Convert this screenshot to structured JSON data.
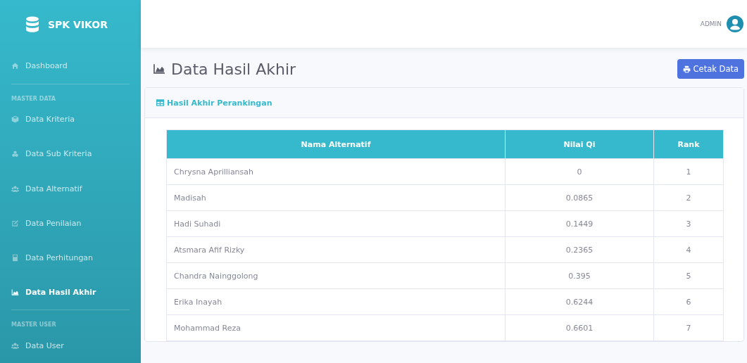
{
  "sidebar": {
    "brand": "SPK VIKOR",
    "items": [
      {
        "kind": "item",
        "label": "Dashboard",
        "selected": false
      },
      {
        "kind": "divider"
      },
      {
        "kind": "heading",
        "label": "MASTER DATA"
      },
      {
        "kind": "item",
        "label": "Data Kriteria",
        "selected": false
      },
      {
        "kind": "item",
        "label": "Data Sub Kriteria",
        "selected": false
      },
      {
        "kind": "item",
        "label": "Data Alternatif",
        "selected": false
      },
      {
        "kind": "item",
        "label": "Data Penilaian",
        "selected": false
      },
      {
        "kind": "item",
        "label": "Data Perhitungan",
        "selected": false
      },
      {
        "kind": "item",
        "label": "Data Hasil Akhir",
        "selected": true
      },
      {
        "kind": "divider"
      },
      {
        "kind": "heading",
        "label": "MASTER USER"
      },
      {
        "kind": "item",
        "label": "Data User",
        "selected": false
      }
    ]
  },
  "topbar": {
    "user": "ADMIN"
  },
  "page": {
    "title": "Data Hasil Akhir",
    "print_button": "Cetak Data"
  },
  "card": {
    "title": "Hasil Akhir Perankingan",
    "table": {
      "columns": [
        "Nama Alternatif",
        "Nilai Qi",
        "Rank"
      ],
      "rows": [
        [
          "Chrysna Aprilliansah",
          "0",
          "1"
        ],
        [
          "Madisah",
          "0.0865",
          "2"
        ],
        [
          "Hadi Suhadi",
          "0.1449",
          "3"
        ],
        [
          "Atsmara Afif Rizky",
          "0.2365",
          "4"
        ],
        [
          "Chandra Nainggolong",
          "0.395",
          "5"
        ],
        [
          "Erika Inayah",
          "0.6244",
          "6"
        ],
        [
          "Mohammad Reza",
          "0.6601",
          "7"
        ]
      ]
    }
  }
}
